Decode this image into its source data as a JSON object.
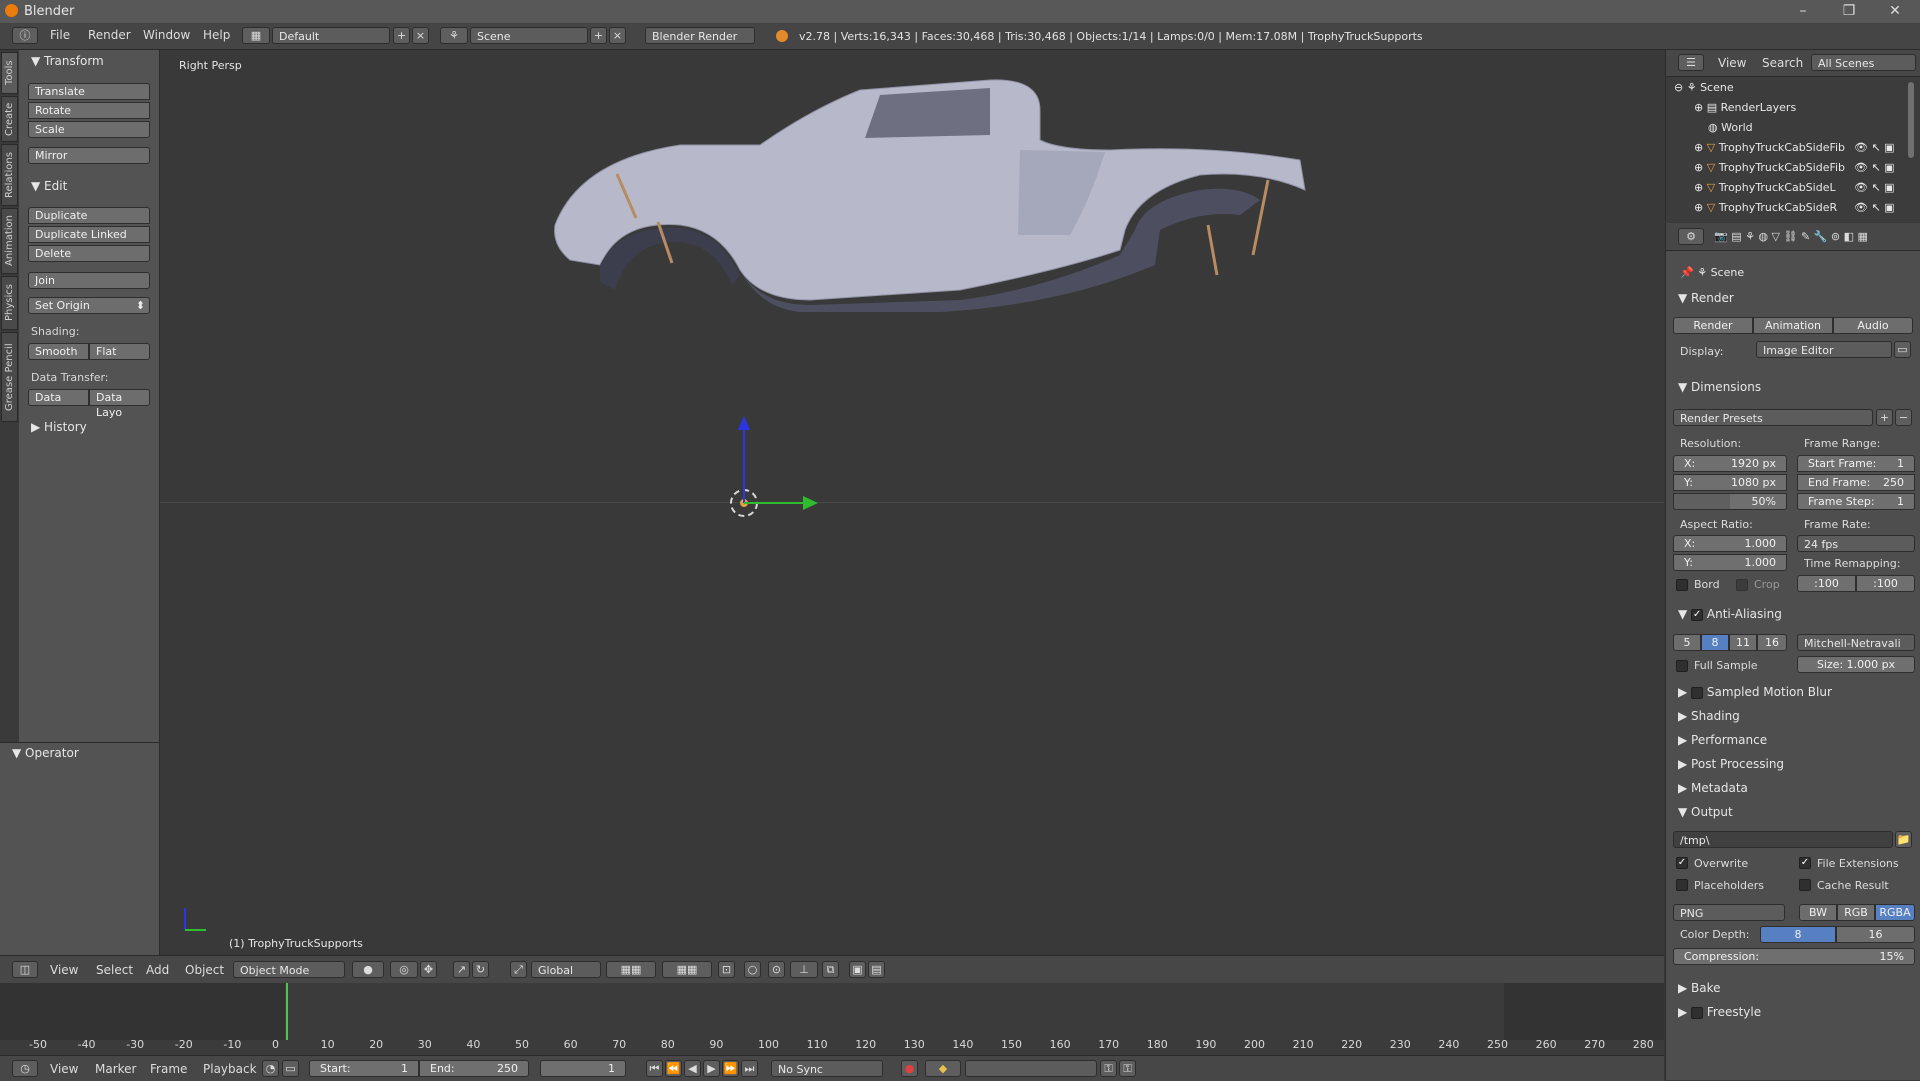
{
  "window": {
    "title": "Blender",
    "minimize": "–",
    "maximize": "❐",
    "close": "✕"
  },
  "info_header": {
    "menus": [
      "File",
      "Render",
      "Window",
      "Help"
    ],
    "layout": "Default",
    "scene": "Scene",
    "engine": "Blender Render",
    "stats": "v2.78 | Verts:16,343 | Faces:30,468 | Tris:30,468 | Objects:1/14 | Lamps:0/0 | Mem:17.08M | TrophyTruckSupports"
  },
  "tool_tabs": [
    "Tools",
    "Create",
    "Relations",
    "Animation",
    "Physics",
    "Grease Pencil"
  ],
  "toolshelf": {
    "transform": {
      "title": "Transform",
      "buttons": [
        "Translate",
        "Rotate",
        "Scale",
        "Mirror"
      ]
    },
    "edit": {
      "title": "Edit",
      "buttons": [
        "Duplicate",
        "Duplicate Linked",
        "Delete",
        "Join"
      ],
      "set_origin": "Set Origin"
    },
    "shading": {
      "label": "Shading:",
      "smooth": "Smooth",
      "flat": "Flat"
    },
    "data_transfer": {
      "label": "Data Transfer:",
      "data": "Data",
      "data_layout": "Data Layo"
    },
    "history": "History",
    "operator": "Operator"
  },
  "viewport": {
    "view_name": "Right Persp",
    "object_label": "(1) TrophyTruckSupports"
  },
  "view3d_header": {
    "menus": [
      "View",
      "Select",
      "Add",
      "Object"
    ],
    "mode": "Object Mode",
    "orientation": "Global"
  },
  "timeline": {
    "ticks": [
      "-50",
      "-40",
      "-30",
      "-20",
      "-10",
      "0",
      "10",
      "20",
      "30",
      "40",
      "50",
      "60",
      "70",
      "80",
      "90",
      "100",
      "110",
      "120",
      "130",
      "140",
      "150",
      "160",
      "170",
      "180",
      "190",
      "200",
      "210",
      "220",
      "230",
      "240",
      "250",
      "260",
      "270",
      "280"
    ],
    "menus": [
      "View",
      "Marker",
      "Frame",
      "Playback"
    ],
    "start": "Start:",
    "start_val": "1",
    "end": "End:",
    "end_val": "250",
    "current": "1",
    "sync": "No Sync"
  },
  "outliner": {
    "menus": [
      "View",
      "Search"
    ],
    "filter": "All Scenes",
    "items": [
      "Scene",
      "RenderLayers",
      "World",
      "TrophyTruckCabSideFib",
      "TrophyTruckCabSideFib",
      "TrophyTruckCabSideL",
      "TrophyTruckCabSideR"
    ]
  },
  "properties": {
    "context": "Scene",
    "render": {
      "title": "Render",
      "render": "Render",
      "animation": "Animation",
      "audio": "Audio",
      "display_label": "Display:",
      "display": "Image Editor"
    },
    "dimensions": {
      "title": "Dimensions",
      "presets": "Render Presets",
      "resolution": "Resolution:",
      "res_x": "X:",
      "res_x_val": "1920 px",
      "res_y": "Y:",
      "res_y_val": "1080 px",
      "res_pct": "50%",
      "frame_range": "Frame Range:",
      "start": "Start Frame:",
      "start_val": "1",
      "end": "End Frame:",
      "end_val": "250",
      "step": "Frame Step:",
      "step_val": "1",
      "aspect": "Aspect Ratio:",
      "asp_x": "X:",
      "asp_x_val": "1.000",
      "asp_y": "Y:",
      "asp_y_val": "1.000",
      "frame_rate": "Frame Rate:",
      "fps": "24 fps",
      "time_remap": "Time Remapping:",
      "old": "100",
      "new": "100",
      "bord": "Bord",
      "crop": "Crop"
    },
    "aa": {
      "title": "Anti-Aliasing",
      "samples": [
        "5",
        "8",
        "11",
        "16"
      ],
      "filter": "Mitchell-Netravali",
      "full_sample": "Full Sample",
      "size_label": "Size:",
      "size_val": "1.000 px"
    },
    "collapsed": [
      "Sampled Motion Blur",
      "Shading",
      "Performance",
      "Post Processing",
      "Metadata"
    ],
    "output": {
      "title": "Output",
      "path": "/tmp\\",
      "overwrite": "Overwrite",
      "file_ext": "File Extensions",
      "placeholders": "Placeholders",
      "cache": "Cache Result",
      "format": "PNG",
      "bw": "BW",
      "rgb": "RGB",
      "rgba": "RGBA",
      "depth_label": "Color Depth:",
      "depth8": "8",
      "depth16": "16",
      "compression_label": "Compression:",
      "compression_val": "15%"
    },
    "bake": "Bake",
    "freestyle": "Freestyle"
  }
}
